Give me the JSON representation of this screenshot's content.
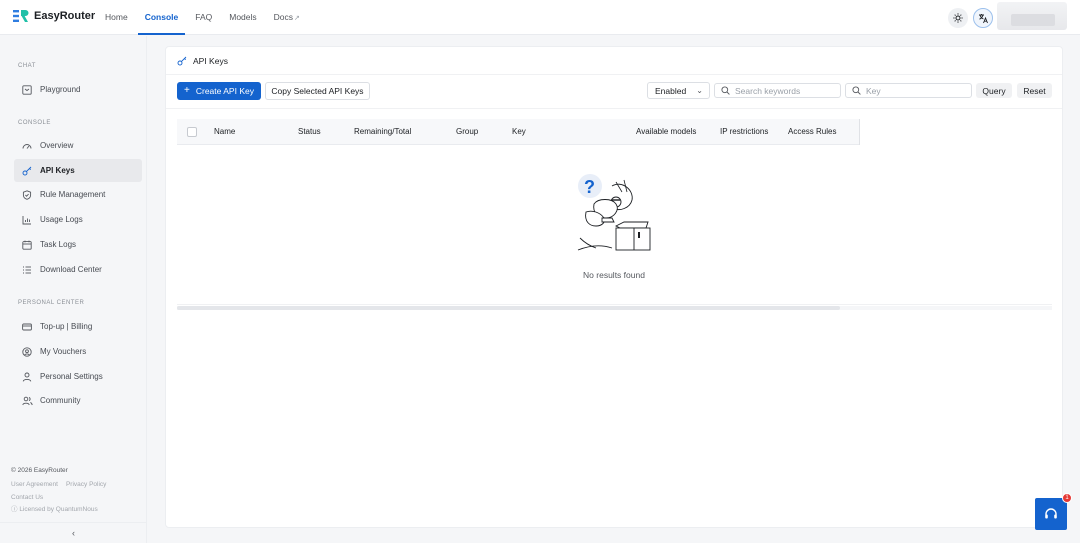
{
  "app": {
    "name": "EasyRouter"
  },
  "nav": [
    {
      "label": "Home"
    },
    {
      "label": "Console",
      "active": true
    },
    {
      "label": "FAQ"
    },
    {
      "label": "Models"
    },
    {
      "label": "Docs",
      "external": true
    }
  ],
  "sidebar": {
    "sections": [
      {
        "label": "CHAT",
        "items": [
          {
            "label": "Playground",
            "icon": "playground-icon"
          }
        ]
      },
      {
        "label": "CONSOLE",
        "items": [
          {
            "label": "Overview",
            "icon": "gauge-icon"
          },
          {
            "label": "API Keys",
            "icon": "key-icon",
            "active": true
          },
          {
            "label": "Rule Management",
            "icon": "shield-icon"
          },
          {
            "label": "Usage Logs",
            "icon": "chart-icon"
          },
          {
            "label": "Task Logs",
            "icon": "calendar-icon"
          },
          {
            "label": "Download Center",
            "icon": "list-icon"
          }
        ]
      },
      {
        "label": "PERSONAL CENTER",
        "items": [
          {
            "label": "Top-up | Billing",
            "icon": "card-icon"
          },
          {
            "label": "My Vouchers",
            "icon": "voucher-icon"
          },
          {
            "label": "Personal Settings",
            "icon": "user-icon"
          },
          {
            "label": "Community",
            "icon": "users-icon"
          }
        ]
      }
    ],
    "footer": {
      "copyright": "© 2026 EasyRouter",
      "user_agreement": "User Agreement",
      "privacy_policy": "Privacy Policy",
      "contact": "Contact Us",
      "license": "Licensed by QuantumNous"
    },
    "collapse_glyph": "‹"
  },
  "page": {
    "title": "API Keys",
    "create_button": "Create API Key",
    "copy_button": "Copy Selected API Keys",
    "status_filter": "Enabled",
    "search_placeholder": "Search keywords",
    "key_placeholder": "Key",
    "query_button": "Query",
    "reset_button": "Reset"
  },
  "table": {
    "columns": [
      "Name",
      "Status",
      "Remaining/Total",
      "Group",
      "Key",
      "Available models",
      "IP restrictions",
      "Access Rules"
    ],
    "empty_text": "No results found"
  },
  "support": {
    "badge_count": "1"
  },
  "colors": {
    "accent": "#1463ce",
    "badge": "#e53935"
  }
}
